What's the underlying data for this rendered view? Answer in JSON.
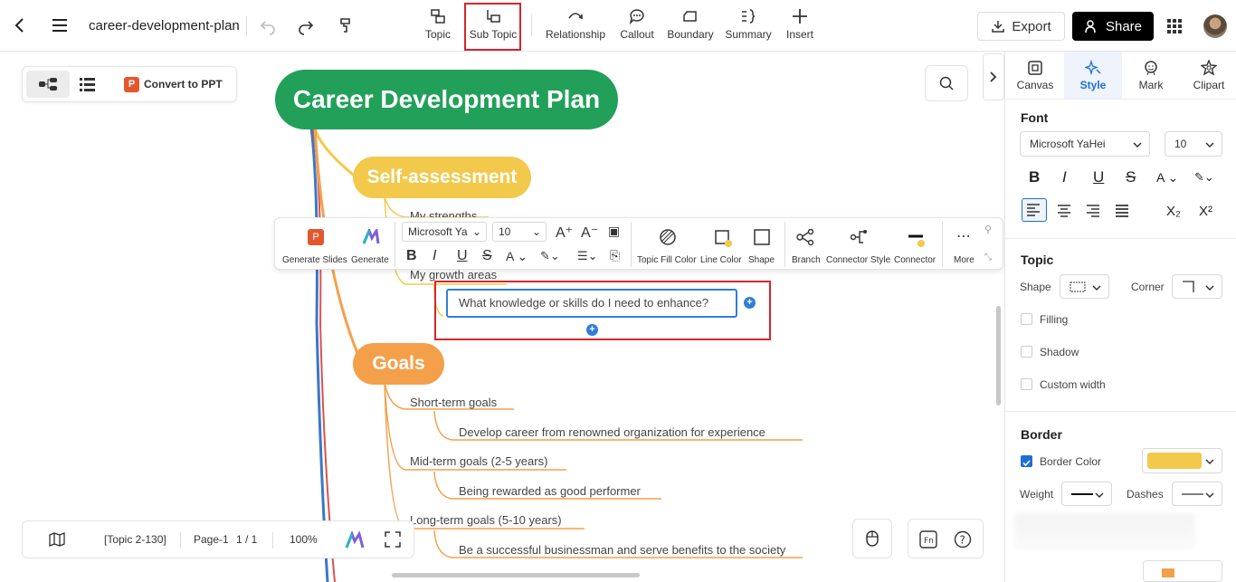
{
  "header": {
    "file_name": "career-development-plan",
    "tools": [
      {
        "id": "topic",
        "label": "Topic"
      },
      {
        "id": "subtopic",
        "label": "Sub Topic"
      },
      {
        "id": "relationship",
        "label": "Relationship"
      },
      {
        "id": "callout",
        "label": "Callout"
      },
      {
        "id": "boundary",
        "label": "Boundary"
      },
      {
        "id": "summary",
        "label": "Summary"
      },
      {
        "id": "insert",
        "label": "Insert"
      }
    ],
    "export_label": "Export",
    "share_label": "Share",
    "highlight_color": "#d9242b"
  },
  "canvas": {
    "convert_label": "Convert to PPT",
    "root": "Career Development Plan",
    "self_assessment": {
      "title": "Self-assessment",
      "children": [
        "My strengths",
        "My growth areas"
      ],
      "selected_subtopic": "What knowledge or skills do I need to enhance?"
    },
    "goals": {
      "title": "Goals",
      "items": [
        {
          "label": "Short-term goals",
          "child": "Develop career from renowned organization for experience"
        },
        {
          "label": "Mid-term goals (2-5 years)",
          "child": "Being rewarded as good performer"
        },
        {
          "label": "Long-term goals (5-10 years)",
          "child": "Be a successful businessman and serve benefits to the society"
        }
      ]
    },
    "colors": {
      "root": "#22a05a",
      "self": "#f3c94c",
      "goals": "#f4a04b",
      "select": "#2f7ed8"
    }
  },
  "floating_toolbar": {
    "generate_slides": "Generate Slides",
    "generate": "Generate",
    "font": "Microsoft Ya",
    "size": "10",
    "topic_fill": "Topic Fill Color",
    "line_color": "Line Color",
    "shape": "Shape",
    "branch": "Branch",
    "connector_style": "Connector Style",
    "connector": "Connector",
    "more": "More"
  },
  "status": {
    "topic_count": "[Topic 2-130]",
    "page_label": "Page-1",
    "page_index": "1 / 1",
    "zoom": "100%"
  },
  "right_panel": {
    "tabs": [
      {
        "id": "canvas",
        "label": "Canvas"
      },
      {
        "id": "style",
        "label": "Style"
      },
      {
        "id": "mark",
        "label": "Mark"
      },
      {
        "id": "clipart",
        "label": "Clipart"
      }
    ],
    "font_section": "Font",
    "font_family": "Microsoft YaHei",
    "font_size": "10",
    "topic_section": "Topic",
    "shape_label": "Shape",
    "corner_label": "Corner",
    "filling_label": "Filling",
    "shadow_label": "Shadow",
    "custom_width_label": "Custom width",
    "border_section": "Border",
    "border_color_label": "Border Color",
    "border_color": "#f3c94c",
    "weight_label": "Weight",
    "dashes_label": "Dashes",
    "accent": "#1e6fd9"
  }
}
